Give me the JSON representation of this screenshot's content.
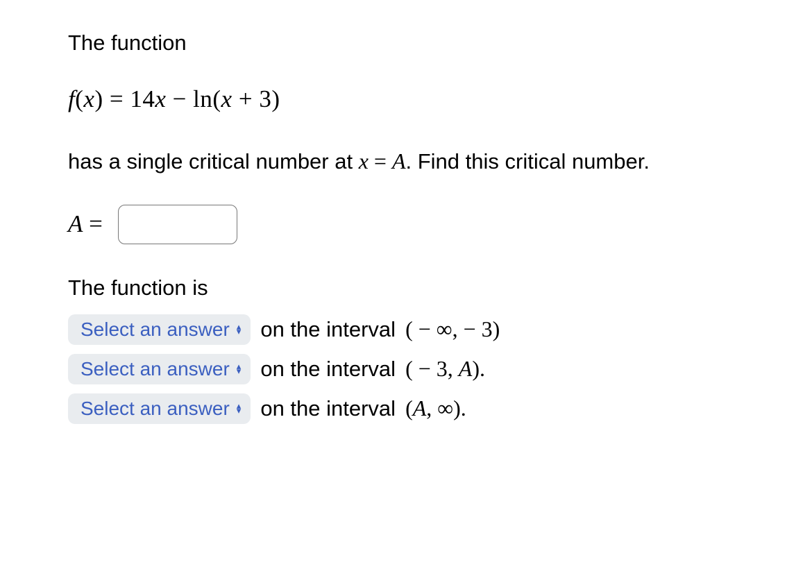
{
  "intro_text": "The function",
  "equation": {
    "lhs_f": "f",
    "lhs_paren_open": "(",
    "lhs_var": "x",
    "lhs_paren_close": ")",
    "eq": " = ",
    "term1_coeff": "14",
    "term1_var": "x",
    "minus": " − ",
    "ln": "ln",
    "paren_open": "(",
    "inner_var": "x",
    "plus": " + ",
    "inner_const": "3",
    "paren_close": ")"
  },
  "prompt": {
    "part1": "has a single critical number at ",
    "x": "x",
    "eq": " = ",
    "A": "A",
    "part2": ". Find this critical number."
  },
  "answer": {
    "label_A": "A",
    "label_eq": " = "
  },
  "section": "The function is",
  "rows": [
    {
      "select_label": "Select an answer",
      "interval_prefix": "on the interval ",
      "interval_math": "( − ∞,  − 3)"
    },
    {
      "select_label": "Select an answer",
      "interval_prefix": "on the interval ",
      "interval_math_open": "( − 3, ",
      "interval_A": "A",
      "interval_math_close": ")."
    },
    {
      "select_label": "Select an answer",
      "interval_prefix": "on the interval ",
      "interval_math_open": "(",
      "interval_A": "A",
      "interval_math_close": ", ∞)."
    }
  ]
}
